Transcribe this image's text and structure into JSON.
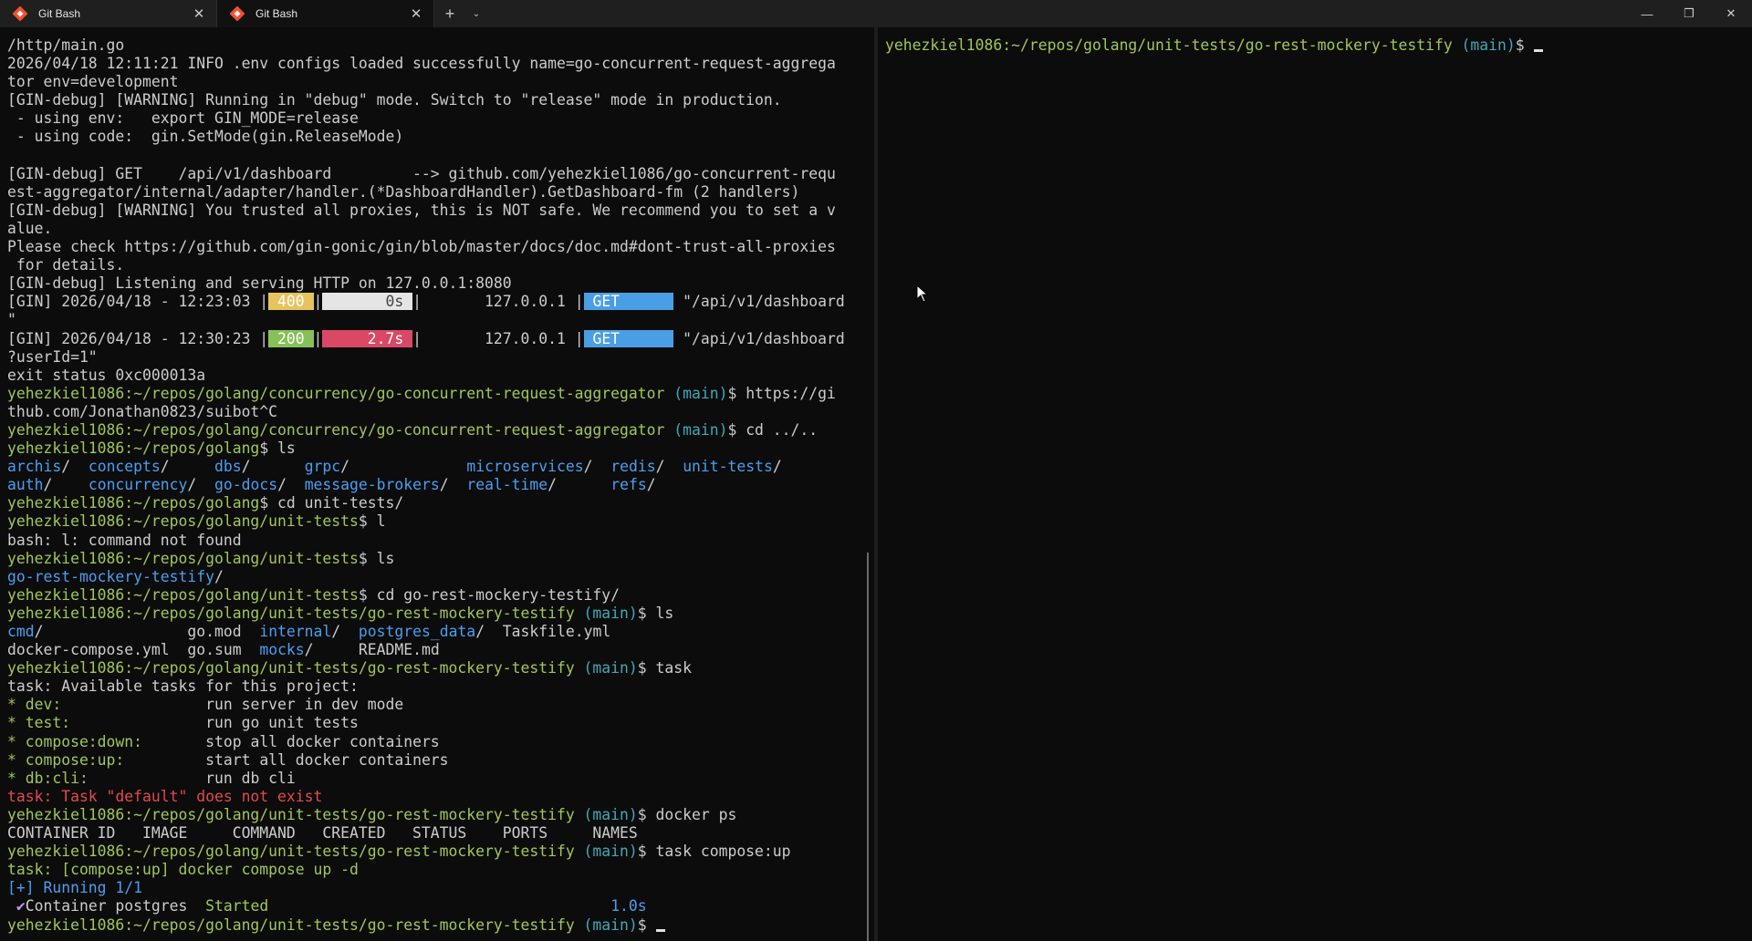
{
  "tabs": [
    {
      "title": "Git Bash",
      "icon": "git-bash-icon"
    },
    {
      "title": "Git Bash",
      "icon": "git-bash-icon"
    }
  ],
  "titlebar": {
    "close_tab_glyph": "✕",
    "new_tab_glyph": "+",
    "dropdown_glyph": "⌄",
    "minimize_glyph": "—",
    "maximize_glyph": "❐",
    "close_glyph": "✕"
  },
  "left": {
    "l01": "/http/main.go",
    "l02": "2026/04/18 12:11:21 INFO .env configs loaded successfully name=go-concurrent-request-aggrega",
    "l03": "tor env=development",
    "l04": "[GIN-debug] [WARNING] Running in \"debug\" mode. Switch to \"release\" mode in production.",
    "l05": " - using env:   export GIN_MODE=release",
    "l06": " - using code:  gin.SetMode(gin.ReleaseMode)",
    "l07": "",
    "l08": "[GIN-debug] GET    /api/v1/dashboard         --> github.com/yehezkiel1086/go-concurrent-requ",
    "l09": "est-aggregator/internal/adapter/handler.(*DashboardHandler).GetDashboard-fm (2 handlers)",
    "l10": "[GIN-debug] [WARNING] You trusted all proxies, this is NOT safe. We recommend you to set a v",
    "l11": "alue.",
    "l12": "Please check https://github.com/gin-gonic/gin/blob/master/docs/doc.md#dont-trust-all-proxies",
    "l13": " for details.",
    "l14": "[GIN-debug] Listening and serving HTTP on 127.0.0.1:8080",
    "gin1": {
      "prefix": "[GIN] 2026/04/18 - 12:23:03 |",
      "status": " 400 ",
      "sep1": "|",
      "latency": "       0s ",
      "sep2": "|       127.0.0.1 |",
      "method": " GET      ",
      "path": " \"/api/v1/dashboard"
    },
    "l16": "\"",
    "gin2": {
      "prefix": "[GIN] 2026/04/18 - 12:30:23 |",
      "status": " 200 ",
      "sep1": "|",
      "latency": "     2.7s ",
      "sep2": "|       127.0.0.1 |",
      "method": " GET      ",
      "path": " \"/api/v1/dashboard"
    },
    "l18": "?userId=1\"",
    "l19": "exit status 0xc000013a",
    "p1_user": "yehezkiel1086:~/repos/golang/concurrency/go-concurrent-request-aggregator",
    "p1_branch": " (main)",
    "p1_cmd": "$ https://gi",
    "l21": "thub.com/Jonathan0823/suibot^C",
    "p2_user": "yehezkiel1086:~/repos/golang/concurrency/go-concurrent-request-aggregator",
    "p2_branch": " (main)",
    "p2_cmd": "$ cd ../..",
    "p3_user": "yehezkiel1086:~/repos/golang",
    "p3_cmd": "$ ls",
    "ls1": [
      {
        "dir": "archis",
        "pad": "/  "
      },
      {
        "dir": "concepts",
        "pad": "/     "
      },
      {
        "dir": "dbs",
        "pad": "/      "
      },
      {
        "dir": "grpc",
        "pad": "/             "
      },
      {
        "dir": "microservices",
        "pad": "/  "
      },
      {
        "dir": "redis",
        "pad": "/  "
      },
      {
        "dir": "unit-tests",
        "pad": "/"
      }
    ],
    "ls2": [
      {
        "dir": "auth",
        "pad": "/    "
      },
      {
        "dir": "concurrency",
        "pad": "/  "
      },
      {
        "dir": "go-docs",
        "pad": "/  "
      },
      {
        "dir": "message-brokers",
        "pad": "/  "
      },
      {
        "dir": "real-time",
        "pad": "/      "
      },
      {
        "dir": "refs",
        "pad": "/"
      }
    ],
    "p4_user": "yehezkiel1086:~/repos/golang",
    "p4_cmd": "$ cd unit-tests/",
    "p5_user": "yehezkiel1086:~/repos/golang/unit-tests",
    "p5_cmd": "$ l",
    "l28": "bash: l: command not found",
    "p6_user": "yehezkiel1086:~/repos/golang/unit-tests",
    "p6_cmd": "$ ls",
    "ls3_dir": "go-rest-mockery-testify",
    "ls3_pad": "/",
    "p7_user": "yehezkiel1086:~/repos/golang/unit-tests",
    "p7_cmd": "$ cd go-rest-mockery-testify/",
    "p8_user": "yehezkiel1086:~/repos/golang/unit-tests/go-rest-mockery-testify",
    "p8_branch": " (main)",
    "p8_cmd": "$ ls",
    "ls4": {
      "cmd": "cmd",
      "cmd_pad": "/                ",
      "gomod": "go.mod  ",
      "internal": "internal",
      "internal_pad": "/  ",
      "postgres": "postgres_data",
      "postgres_pad": "/  ",
      "taskfile": "Taskfile.yml"
    },
    "ls5": {
      "compose": "docker-compose.yml  ",
      "gosum": "go.sum  ",
      "mocks": "mocks",
      "mocks_pad": "/     ",
      "readme": "README.md"
    },
    "p9_user": "yehezkiel1086:~/repos/golang/unit-tests/go-rest-mockery-testify",
    "p9_branch": " (main)",
    "p9_cmd": "$ task",
    "l37": "task: Available tasks for this project:",
    "tasks": [
      {
        "name": "* dev:           ",
        "desc": "     run server in dev mode"
      },
      {
        "name": "* test:          ",
        "desc": "     run go unit tests"
      },
      {
        "name": "* compose:down:  ",
        "desc": "     stop all docker containers"
      },
      {
        "name": "* compose:up:    ",
        "desc": "     start all docker containers"
      },
      {
        "name": "* db:cli:        ",
        "desc": "     run db cli"
      }
    ],
    "l43": "task: Task \"default\" does not exist",
    "p10_user": "yehezkiel1086:~/repos/golang/unit-tests/go-rest-mockery-testify",
    "p10_branch": " (main)",
    "p10_cmd": "$ docker ps",
    "l45": "CONTAINER ID   IMAGE     COMMAND   CREATED   STATUS    PORTS     NAMES",
    "p11_user": "yehezkiel1086:~/repos/golang/unit-tests/go-rest-mockery-testify",
    "p11_branch": " (main)",
    "p11_cmd": "$ task compose:up",
    "l47": "task: [compose:up] docker compose up -d",
    "l48": "[+] Running 1/1",
    "l49_check": " ✔",
    "l49_text": "Container postgres  ",
    "l49_status": "Started",
    "l49_pad": "                                      ",
    "l49_time": "1.0s",
    "p12_user": "yehezkiel1086:~/repos/golang/unit-tests/go-rest-mockery-testify",
    "p12_branch": " (main)",
    "p12_cmd": "$ "
  },
  "right": {
    "p_user": "yehezkiel1086:~/repos/golang/unit-tests/go-rest-mockery-testify",
    "p_branch": " (main)",
    "p_cmd": "$ "
  }
}
